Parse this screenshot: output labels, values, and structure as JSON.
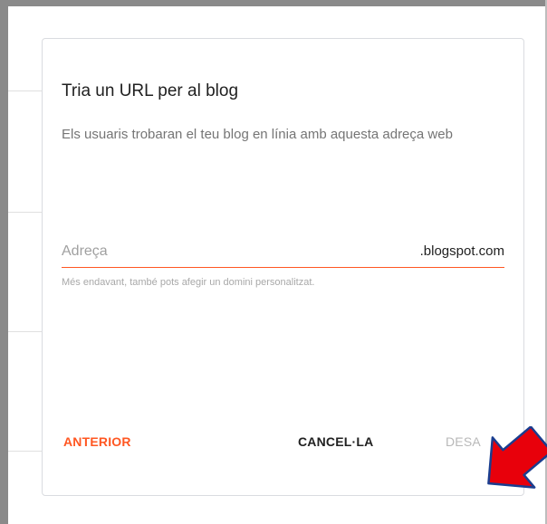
{
  "dialog": {
    "title": "Tria un URL per al blog",
    "description": "Els usuaris trobaran el teu blog en línia amb aquesta adreça web",
    "address_field": {
      "value": "",
      "placeholder": "Adreça",
      "suffix": ".blogspot.com"
    },
    "helper_text": "Més endavant, també pots afegir un domini personalitzat.",
    "buttons": {
      "back_label": "ANTERIOR",
      "cancel_label": "CANCEL·LA",
      "save_label": "DESA"
    }
  },
  "colors": {
    "accent": "#ff5722",
    "annotation_arrow": "#e8000b"
  },
  "annotation": {
    "icon": "red-arrow-icon"
  }
}
